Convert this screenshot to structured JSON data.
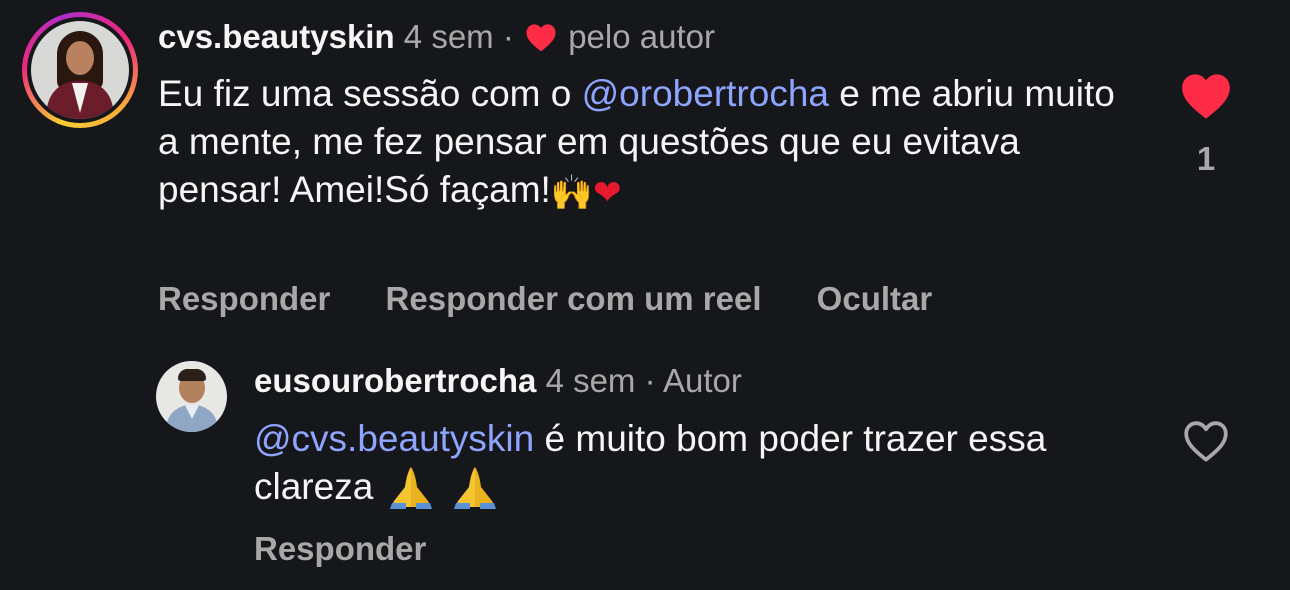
{
  "comment": {
    "username": "cvs.beautyskin",
    "time": "4 sem",
    "separator": "·",
    "liked_by_author": "pelo autor",
    "text_before": "Eu fiz uma sessão com o ",
    "mention": "@orobertrocha",
    "text_after": "  e me abriu muito a mente, me fez pensar em questões que eu evitava pensar! Amei!Só façam!",
    "emoji_hands": "🙌",
    "emoji_heart": "❤",
    "like_count": "1",
    "actions": [
      "Responder",
      "Responder com um reel",
      "Ocultar"
    ],
    "colors": {
      "like": "#fe2c46",
      "mention": "#8ea4ff",
      "muted": "#a8a8a8"
    }
  },
  "reply": {
    "username": "eusourobertrocha",
    "time": "4 sem",
    "separator": "·",
    "badge": "Autor",
    "mention": "@cvs.beautyskin",
    "text": " é muito bom poder trazer essa clareza ",
    "emoji_pray": "🙏🙏",
    "action": "Responder"
  },
  "icons": [
    "heart-filled-icon",
    "heart-outline-icon",
    "pray-emoji-icon",
    "raised-hands-emoji-icon"
  ]
}
